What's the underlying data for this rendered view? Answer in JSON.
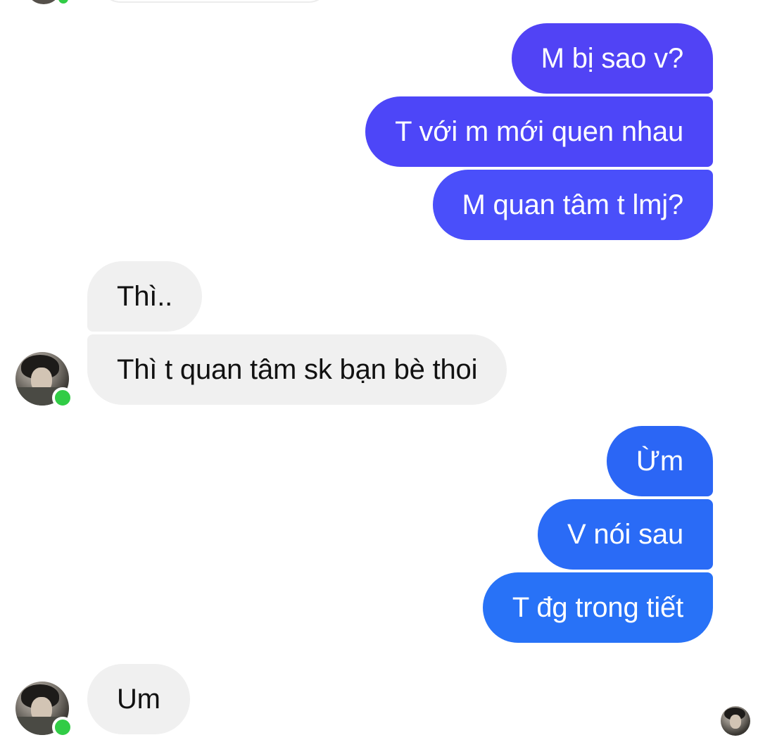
{
  "conversation": {
    "messages": [
      {
        "sender": "me",
        "text": "M bị sao v?"
      },
      {
        "sender": "me",
        "text": "T với m mới quen nhau"
      },
      {
        "sender": "me",
        "text": "M quan tâm t lmj?"
      },
      {
        "sender": "contact",
        "text": "Thì.."
      },
      {
        "sender": "contact",
        "text": "Thì t quan tâm sk bạn bè thoi"
      },
      {
        "sender": "me",
        "text": "Ừm"
      },
      {
        "sender": "me",
        "text": "V nói sau"
      },
      {
        "sender": "me",
        "text": "T đg trong tiết"
      },
      {
        "sender": "contact",
        "text": "Um"
      }
    ]
  },
  "colors": {
    "sent_bubble_top": "#5143f5",
    "sent_bubble_bottom": "#2872f7",
    "received_bubble": "#f0f0f0",
    "online_status": "#31cc46"
  },
  "icons": {
    "contact_avatar": "contact-avatar-photo",
    "online_indicator": "online-dot",
    "read_receipt": "seen-avatar"
  }
}
